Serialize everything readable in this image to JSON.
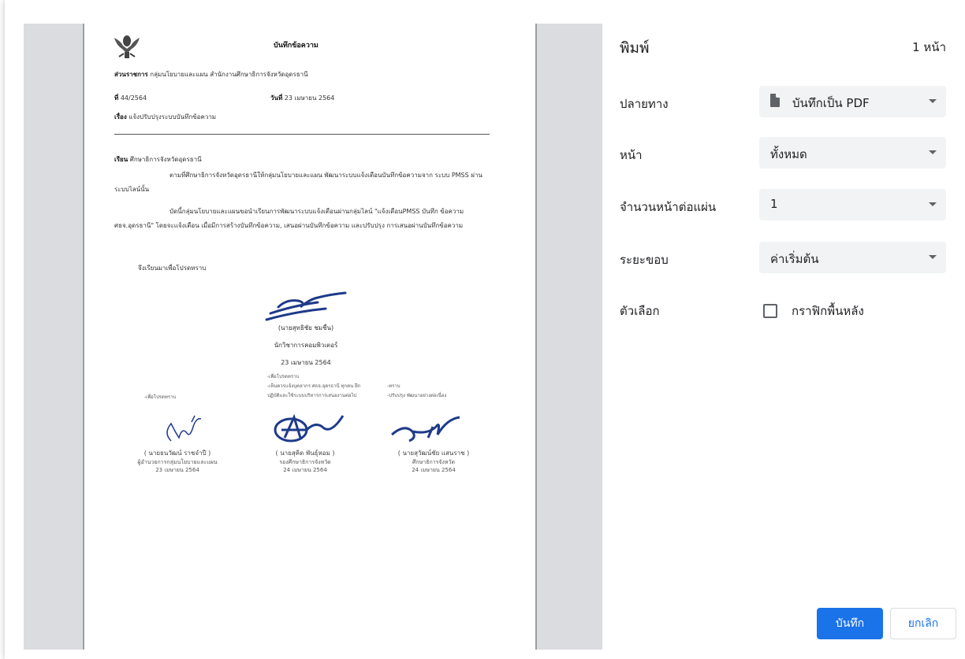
{
  "doc": {
    "heading": "บันทึกข้อความ",
    "agency_label": "ส่วนราชการ",
    "agency_value": "กลุ่มนโยบายและแผน สำนักงานศึกษาธิการจังหวัดอุดรธานี",
    "no_label": "ที่",
    "no_value": "44/2564",
    "date_label": "วันที่",
    "date_value": "23 เมษายน 2564",
    "subject_label": "เรื่อง",
    "subject_value": "แจ้งปรับปรุงระบบบันทึกข้อความ",
    "to_label": "เรียน",
    "to_value": "ศึกษาธิการจังหวัดอุดรธานี",
    "para1": "ตามที่ศึกษาธิการจังหวัดอุดรธานีให้กลุ่มนโยบายและแผน พัฒนาระบบแจ้งเตือนบันทึกข้อความจาก ระบบ PMSS ผ่านระบบไลน์นั้น",
    "para2": "บัดนี้กลุ่มนโยบายและแผนขอนำเรียนการพัฒนาระบบแจ้งเตือนผ่านกลุ่มไลน์ \"แจ้งเตือนPMSS บันทึก ข้อความ ศธจ.อุดรธานี\" โดยจะแจ้งเตือน เมื่อมีการสร้างบันทึกข้อความ, เสนอผ่านบันทึกข้อความ และปรับปรุง การเสนอผ่านบันทึกข้อความ",
    "closing": "จึงเรียนมาเพื่อโปรดทราบ",
    "signer_name": "(นายสุทธิชัย ชมชื่น)",
    "signer_title": "นักวิชาการคอมพิวเตอร์",
    "signer_date": "23 เมษายน 2564",
    "note_mid_1": "-เพื่อโปรดทราบ",
    "note_mid_2": "-เห็นควรแจ้งบุคลากร ศธจ.อุดรธานี ทุกคน ฝึก",
    "note_mid_3": "ปฏิบัติและใช้ระบบบริหารการเสนองานต่อไป",
    "note_left": "-เพื่อโปรดทราบ",
    "note_right_1": "-ทราบ",
    "note_right_2": "-ปรับปรุง พัฒนาอย่างต่อเนื่อง",
    "sig1_name": "( นายธนวัฒน์ ราชจำปี )",
    "sig1_title": "ผู้อำนวยการกลุ่มนโยบายและแผน",
    "sig1_date": "23 เมษายน 2564",
    "sig2_name": "( นายสุคิด พันธุ์หอม )",
    "sig2_title": "รองศึกษาธิการจังหวัด",
    "sig2_date": "24 เมษายน 2564",
    "sig3_name": "( นายสุวัฒน์ชัย แสนราช )",
    "sig3_title": "ศึกษาธิการจังหวัด",
    "sig3_date": "24 เมษายน 2564"
  },
  "panel": {
    "title": "พิมพ์",
    "pages": "1 หน้า",
    "destination_label": "ปลายทาง",
    "destination_value": "บันทึกเป็น PDF",
    "pages_label": "หน้า",
    "pages_value": "ทั้งหมด",
    "per_sheet_label": "จำนวนหน้าต่อแผ่น",
    "per_sheet_value": "1",
    "margins_label": "ระยะขอบ",
    "margins_value": "ค่าเริ่มต้น",
    "options_label": "ตัวเลือก",
    "background_graphics_label": "กราฟิกพื้นหลัง",
    "background_graphics_checked": false,
    "save_label": "บันทึก",
    "cancel_label": "ยกเลิก"
  },
  "colors": {
    "accent": "#1a73e8",
    "select_bg": "#f1f3f4",
    "preview_bg": "#dadce0",
    "signature_ink": "#1e3a8a"
  },
  "icons": {
    "emblem": "garuda-emblem-icon",
    "file": "file-icon",
    "dropdown": "chevron-down-icon",
    "checkbox": "checkbox-icon"
  }
}
